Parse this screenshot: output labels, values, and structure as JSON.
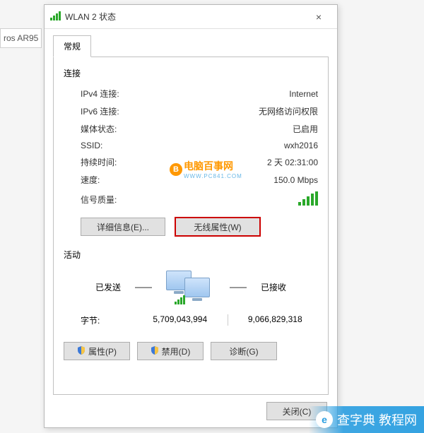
{
  "background_fragment": "ros AR95",
  "window": {
    "title": "WLAN 2 状态",
    "tab": "常规",
    "close_button": "×"
  },
  "connection": {
    "group_label": "连接",
    "rows": {
      "ipv4_label": "IPv4 连接:",
      "ipv4_value": "Internet",
      "ipv6_label": "IPv6 连接:",
      "ipv6_value": "无网络访问权限",
      "media_label": "媒体状态:",
      "media_value": "已启用",
      "ssid_label": "SSID:",
      "ssid_value": "wxh2016",
      "duration_label": "持续时间:",
      "duration_value": "2 天 02:31:00",
      "speed_label": "速度:",
      "speed_value": "150.0 Mbps",
      "signal_label": "信号质量:"
    },
    "buttons": {
      "details": "详细信息(E)...",
      "wireless_props": "无线属性(W)"
    }
  },
  "activity": {
    "group_label": "活动",
    "sent_label": "已发送",
    "dash": "——",
    "recv_label": "已接收",
    "bytes_label": "字节:",
    "sent_bytes": "5,709,043,994",
    "recv_bytes": "9,066,829,318"
  },
  "bottom_buttons": {
    "properties": "属性(P)",
    "disable": "禁用(D)",
    "diagnose": "诊断(G)"
  },
  "footer": {
    "close": "关闭(C)"
  },
  "watermarks": {
    "center_text": "电脑百事网",
    "center_sub": "WWW.PC841.COM",
    "corner_text": "查字典 教程网"
  }
}
